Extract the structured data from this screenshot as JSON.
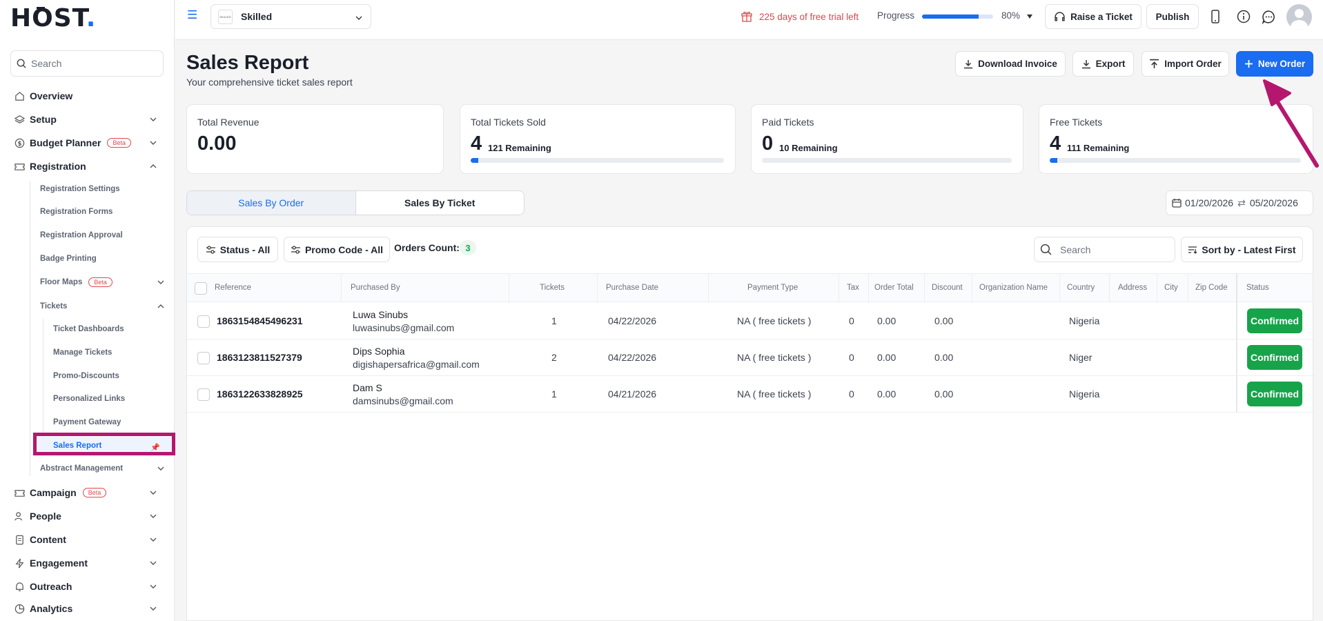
{
  "brand": {
    "logo_text": "HOST",
    "logo_dot": "."
  },
  "sidebar": {
    "search_placeholder": "Search",
    "items": [
      {
        "label": "Overview",
        "icon": "home-icon"
      },
      {
        "label": "Setup",
        "icon": "layers-icon"
      },
      {
        "label": "Budget Planner",
        "icon": "dollar-circle-icon",
        "badge": "Beta"
      },
      {
        "label": "Registration",
        "icon": "ticket-icon"
      },
      {
        "label": "Campaign",
        "icon": "ticket-icon",
        "badge": "Beta"
      },
      {
        "label": "People",
        "icon": "users-icon"
      },
      {
        "label": "Content",
        "icon": "document-icon"
      },
      {
        "label": "Engagement",
        "icon": "bolt-icon"
      },
      {
        "label": "Outreach",
        "icon": "bell-icon"
      },
      {
        "label": "Analytics",
        "icon": "pie-chart-icon"
      }
    ],
    "registration_sub": [
      "Registration Settings",
      "Registration Forms",
      "Registration Approval",
      "Badge Printing",
      "Floor Maps",
      "Tickets",
      "Abstract Management"
    ],
    "floor_maps_badge": "Beta",
    "tickets_sub": [
      "Ticket Dashboards",
      "Manage Tickets",
      "Promo-Discounts",
      "Personalized Links",
      "Payment Gateway",
      "Sales Report"
    ]
  },
  "topbar": {
    "workspace_name": "Skilled",
    "workspace_thumb": "SKILLED",
    "trial_text": "225 days of free trial left",
    "progress_label": "Progress",
    "progress_value": 0.8,
    "progress_pct": "80%",
    "raise_ticket": "Raise a Ticket",
    "publish": "Publish"
  },
  "header": {
    "title": "Sales Report",
    "subtitle": "Your comprehensive ticket sales report",
    "download_invoice": "Download Invoice",
    "export": "Export",
    "import_order": "Import Order",
    "new_order": "New Order"
  },
  "cards": [
    {
      "title": "Total Revenue",
      "value": "0.00"
    },
    {
      "title": "Total Tickets Sold",
      "value": "4",
      "remaining": "121 Remaining",
      "fill": 0.03
    },
    {
      "title": "Paid Tickets",
      "value": "0",
      "remaining": "10 Remaining",
      "fill": 0
    },
    {
      "title": "Free Tickets",
      "value": "4",
      "remaining": "111 Remaining",
      "fill": 0.03
    }
  ],
  "tabs": [
    "Sales By Order",
    "Sales By Ticket"
  ],
  "date_range": {
    "from": "01/20/2026",
    "to": "05/20/2026"
  },
  "filters": {
    "status": "Status - All",
    "promo": "Promo Code - All",
    "orders_count_label": "Orders Count:",
    "orders_count": "3",
    "search_placeholder": "Search",
    "sort": "Sort by - Latest First"
  },
  "table": {
    "columns": [
      "Reference",
      "Purchased By",
      "Tickets",
      "Purchase Date",
      "Payment Type",
      "Tax",
      "Order Total",
      "Discount",
      "Organization Name",
      "Country",
      "Address",
      "City",
      "Zip Code",
      "Status"
    ],
    "rows": [
      {
        "reference": "1863154845496231",
        "name": "Luwa Sinubs",
        "email": "luwasinubs@gmail.com",
        "tickets": "1",
        "date": "04/22/2026",
        "payment": "NA ( free tickets )",
        "tax": "0",
        "total": "0.00",
        "discount": "0.00",
        "country": "Nigeria",
        "status": "Confirmed"
      },
      {
        "reference": "1863123811527379",
        "name": "Dips Sophia",
        "email": "digishapersafrica@gmail.com",
        "tickets": "2",
        "date": "04/22/2026",
        "payment": "NA ( free tickets )",
        "tax": "0",
        "total": "0.00",
        "discount": "0.00",
        "country": "Niger",
        "status": "Confirmed"
      },
      {
        "reference": "1863122633828925",
        "name": "Dam S",
        "email": "damsinubs@gmail.com",
        "tickets": "1",
        "date": "04/21/2026",
        "payment": "NA ( free tickets )",
        "tax": "0",
        "total": "0.00",
        "discount": "0.00",
        "country": "Nigeria",
        "status": "Confirmed"
      }
    ]
  },
  "colors": {
    "accent": "#1a6cf0",
    "success": "#17a34a",
    "annotation": "#b5176e",
    "trial": "#e0474c"
  }
}
